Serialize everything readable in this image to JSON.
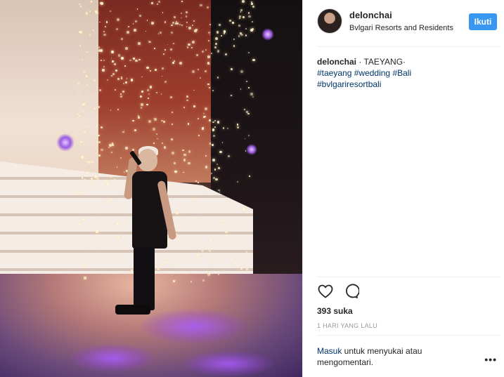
{
  "post": {
    "image_alt": "photo",
    "username": "delonchai",
    "location": "Bvlgari Resorts and Residents",
    "follow_label": "Ikuti",
    "caption": {
      "username": "delonchai",
      "text": " · TAEYANG·",
      "hashtags_line1": [
        "#taeyang",
        "#wedding",
        "#Bali"
      ],
      "hashtags_line2": [
        "#bvlgariresortbali"
      ]
    },
    "likes": "393 suka",
    "time_ago": "1 HARI YANG LALU",
    "login_link": "Masuk",
    "login_text": " untuk menyukai atau mengomentari.",
    "more_label": "•••"
  },
  "icons": {
    "like": "heart-icon",
    "comment": "comment-icon",
    "more": "more-options-icon"
  },
  "colors": {
    "follow_button": "#3897f0",
    "hashtag": "#003569",
    "muted": "#999999",
    "text": "#262626"
  }
}
